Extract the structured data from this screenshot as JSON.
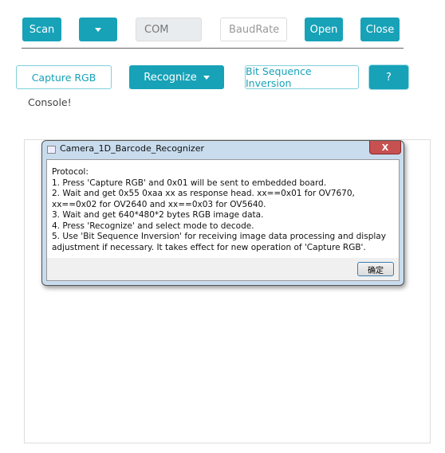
{
  "toolbar": {
    "scan": "Scan",
    "port_value": "COM",
    "baud_placeholder": "BaudRate",
    "open": "Open",
    "close": "Close"
  },
  "actions": {
    "capture": "Capture RGB",
    "recognize": "Recognize",
    "bit_inversion": "Bit Sequence Inversion",
    "help": "?"
  },
  "console": "Console!",
  "dialog": {
    "title": "Camera_1D_Barcode_Recognizer",
    "close_glyph": "X",
    "ok": "确定",
    "lines": [
      "Protocol:",
      "1. Press 'Capture RGB' and 0x01 will be sent to embedded board.",
      "2. Wait and get 0x55 0xaa xx as response head. xx==0x01 for OV7670, xx==0x02 for OV2640 and xx==0x03 for OV5640.",
      "3. Wait and get 640*480*2 bytes RGB image data.",
      "4. Press 'Recognize' and select mode to decode.",
      "5. Use 'Bit Sequence Inversion' for receiving image data processing and display adjustment if necessary. It takes effect for new operation of 'Capture RGB'."
    ]
  },
  "colors": {
    "accent": "#17a2b8"
  }
}
